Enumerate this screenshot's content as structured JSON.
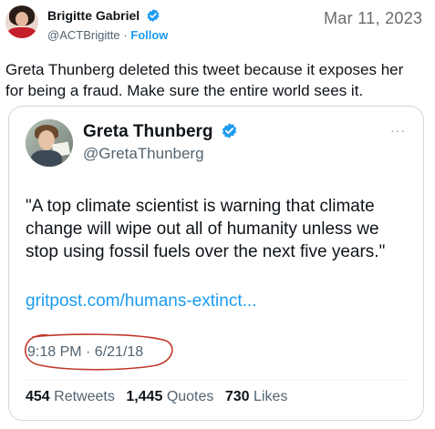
{
  "tweet": {
    "author": {
      "name": "Brigitte Gabriel",
      "handle": "@ACTBrigitte",
      "separator": "·",
      "follow_label": "Follow"
    },
    "date": "Mar 11, 2023",
    "text": "Greta Thunberg deleted this tweet because it exposes her for being a fraud. Make sure the entire world sees it."
  },
  "quoted": {
    "author": {
      "name": "Greta Thunberg",
      "handle": "@GretaThunberg"
    },
    "more_icon": "···",
    "text": "\"A top climate scientist is warning that climate change will wipe out all of humanity unless we stop using fossil fuels over the next five years.\"",
    "link": "gritpost.com/humans-extinct...",
    "timestamp": "9:18 PM · 6/21/18",
    "stats": {
      "retweets_count": "454",
      "retweets_label": "Retweets",
      "quotes_count": "1,445",
      "quotes_label": "Quotes",
      "likes_count": "730",
      "likes_label": "Likes"
    }
  },
  "colors": {
    "accent": "#1d9bf0",
    "annotation": "#c0392b",
    "muted": "#536471"
  },
  "icons": [
    "verified-badge-icon",
    "more-options-icon"
  ]
}
